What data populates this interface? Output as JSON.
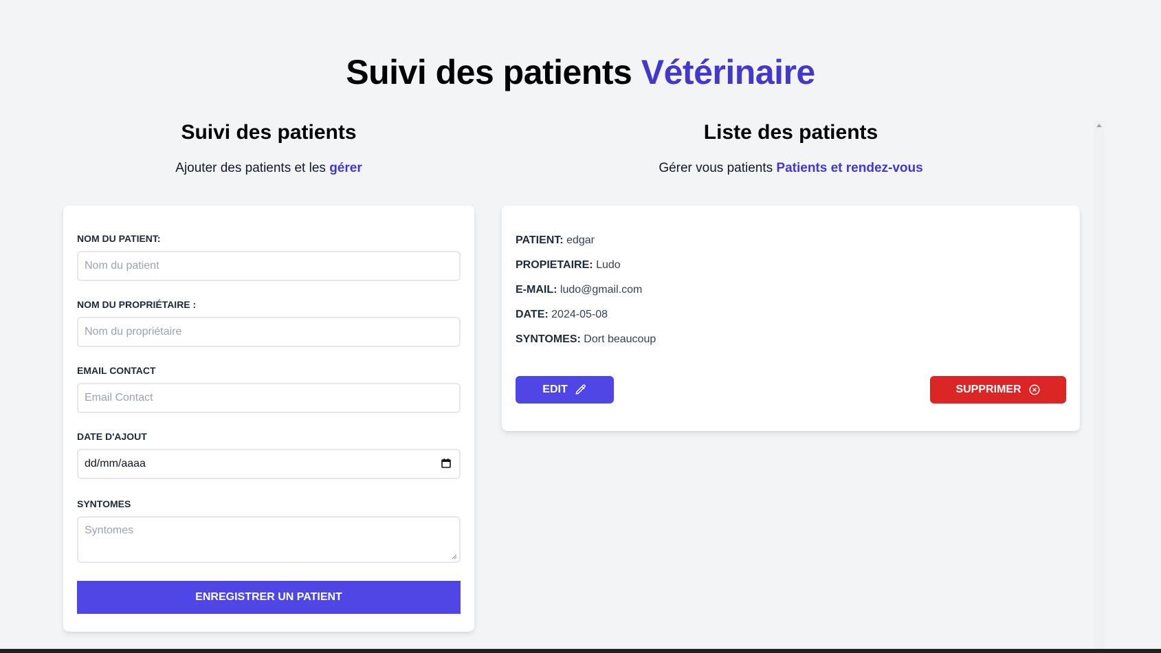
{
  "header": {
    "title_main": "Suivi des patients",
    "title_accent": "Vétérinaire"
  },
  "form_section": {
    "title": "Suivi des patients",
    "subtitle_text": "Ajouter des patients et les",
    "subtitle_link": "gérer",
    "fields": {
      "patient_name": {
        "label": "Nom du patient:",
        "placeholder": "Nom du patient"
      },
      "owner_name": {
        "label": "Nom du propriétaire :",
        "placeholder": "Nom du propriétaire"
      },
      "email": {
        "label": "Email Contact",
        "placeholder": "Email Contact"
      },
      "date": {
        "label": "Date d'ajout",
        "value": "dd/mm/aaaa"
      },
      "symptoms": {
        "label": "Syntomes",
        "placeholder": "Syntomes"
      }
    },
    "submit_label": "Enregistrer un patient"
  },
  "list_section": {
    "title": "Liste des patients",
    "subtitle_text": "Gérer vous patients",
    "subtitle_link": "Patients et rendez-vous",
    "patients": [
      {
        "patient_label": "Patient:",
        "patient": "edgar",
        "owner_label": "Propietaire:",
        "owner": "Ludo",
        "email_label": "E-mail:",
        "email": "ludo@gmail.com",
        "date_label": "Date:",
        "date": "2024-05-08",
        "symptoms_label": "Syntomes:",
        "symptoms": "Dort beaucoup",
        "edit_label": "Edit",
        "delete_label": "Supprimer"
      }
    ]
  },
  "icons": {
    "edit": "pencil-icon",
    "delete": "x-circle-icon",
    "calendar": "calendar-icon"
  },
  "colors": {
    "accent": "#4338ca",
    "button_primary": "#4f46e5",
    "button_danger": "#dc2626",
    "background": "#f3f4f6"
  }
}
